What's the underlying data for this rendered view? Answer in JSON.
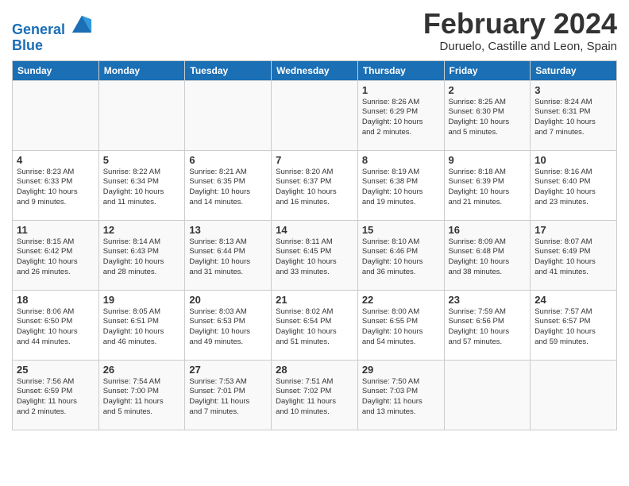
{
  "header": {
    "logo_line1": "General",
    "logo_line2": "Blue",
    "title": "February 2024",
    "subtitle": "Duruelo, Castille and Leon, Spain"
  },
  "calendar": {
    "days_of_week": [
      "Sunday",
      "Monday",
      "Tuesday",
      "Wednesday",
      "Thursday",
      "Friday",
      "Saturday"
    ],
    "weeks": [
      [
        {
          "day": "",
          "info": ""
        },
        {
          "day": "",
          "info": ""
        },
        {
          "day": "",
          "info": ""
        },
        {
          "day": "",
          "info": ""
        },
        {
          "day": "1",
          "info": "Sunrise: 8:26 AM\nSunset: 6:29 PM\nDaylight: 10 hours\nand 2 minutes."
        },
        {
          "day": "2",
          "info": "Sunrise: 8:25 AM\nSunset: 6:30 PM\nDaylight: 10 hours\nand 5 minutes."
        },
        {
          "day": "3",
          "info": "Sunrise: 8:24 AM\nSunset: 6:31 PM\nDaylight: 10 hours\nand 7 minutes."
        }
      ],
      [
        {
          "day": "4",
          "info": "Sunrise: 8:23 AM\nSunset: 6:33 PM\nDaylight: 10 hours\nand 9 minutes."
        },
        {
          "day": "5",
          "info": "Sunrise: 8:22 AM\nSunset: 6:34 PM\nDaylight: 10 hours\nand 11 minutes."
        },
        {
          "day": "6",
          "info": "Sunrise: 8:21 AM\nSunset: 6:35 PM\nDaylight: 10 hours\nand 14 minutes."
        },
        {
          "day": "7",
          "info": "Sunrise: 8:20 AM\nSunset: 6:37 PM\nDaylight: 10 hours\nand 16 minutes."
        },
        {
          "day": "8",
          "info": "Sunrise: 8:19 AM\nSunset: 6:38 PM\nDaylight: 10 hours\nand 19 minutes."
        },
        {
          "day": "9",
          "info": "Sunrise: 8:18 AM\nSunset: 6:39 PM\nDaylight: 10 hours\nand 21 minutes."
        },
        {
          "day": "10",
          "info": "Sunrise: 8:16 AM\nSunset: 6:40 PM\nDaylight: 10 hours\nand 23 minutes."
        }
      ],
      [
        {
          "day": "11",
          "info": "Sunrise: 8:15 AM\nSunset: 6:42 PM\nDaylight: 10 hours\nand 26 minutes."
        },
        {
          "day": "12",
          "info": "Sunrise: 8:14 AM\nSunset: 6:43 PM\nDaylight: 10 hours\nand 28 minutes."
        },
        {
          "day": "13",
          "info": "Sunrise: 8:13 AM\nSunset: 6:44 PM\nDaylight: 10 hours\nand 31 minutes."
        },
        {
          "day": "14",
          "info": "Sunrise: 8:11 AM\nSunset: 6:45 PM\nDaylight: 10 hours\nand 33 minutes."
        },
        {
          "day": "15",
          "info": "Sunrise: 8:10 AM\nSunset: 6:46 PM\nDaylight: 10 hours\nand 36 minutes."
        },
        {
          "day": "16",
          "info": "Sunrise: 8:09 AM\nSunset: 6:48 PM\nDaylight: 10 hours\nand 38 minutes."
        },
        {
          "day": "17",
          "info": "Sunrise: 8:07 AM\nSunset: 6:49 PM\nDaylight: 10 hours\nand 41 minutes."
        }
      ],
      [
        {
          "day": "18",
          "info": "Sunrise: 8:06 AM\nSunset: 6:50 PM\nDaylight: 10 hours\nand 44 minutes."
        },
        {
          "day": "19",
          "info": "Sunrise: 8:05 AM\nSunset: 6:51 PM\nDaylight: 10 hours\nand 46 minutes."
        },
        {
          "day": "20",
          "info": "Sunrise: 8:03 AM\nSunset: 6:53 PM\nDaylight: 10 hours\nand 49 minutes."
        },
        {
          "day": "21",
          "info": "Sunrise: 8:02 AM\nSunset: 6:54 PM\nDaylight: 10 hours\nand 51 minutes."
        },
        {
          "day": "22",
          "info": "Sunrise: 8:00 AM\nSunset: 6:55 PM\nDaylight: 10 hours\nand 54 minutes."
        },
        {
          "day": "23",
          "info": "Sunrise: 7:59 AM\nSunset: 6:56 PM\nDaylight: 10 hours\nand 57 minutes."
        },
        {
          "day": "24",
          "info": "Sunrise: 7:57 AM\nSunset: 6:57 PM\nDaylight: 10 hours\nand 59 minutes."
        }
      ],
      [
        {
          "day": "25",
          "info": "Sunrise: 7:56 AM\nSunset: 6:59 PM\nDaylight: 11 hours\nand 2 minutes."
        },
        {
          "day": "26",
          "info": "Sunrise: 7:54 AM\nSunset: 7:00 PM\nDaylight: 11 hours\nand 5 minutes."
        },
        {
          "day": "27",
          "info": "Sunrise: 7:53 AM\nSunset: 7:01 PM\nDaylight: 11 hours\nand 7 minutes."
        },
        {
          "day": "28",
          "info": "Sunrise: 7:51 AM\nSunset: 7:02 PM\nDaylight: 11 hours\nand 10 minutes."
        },
        {
          "day": "29",
          "info": "Sunrise: 7:50 AM\nSunset: 7:03 PM\nDaylight: 11 hours\nand 13 minutes."
        },
        {
          "day": "",
          "info": ""
        },
        {
          "day": "",
          "info": ""
        }
      ]
    ]
  }
}
